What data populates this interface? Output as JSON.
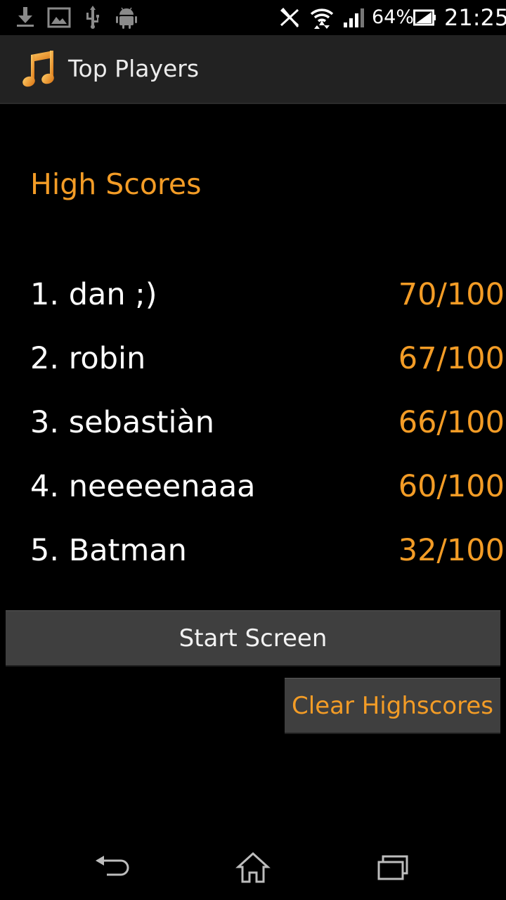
{
  "status_bar": {
    "icons_left": [
      "download-icon",
      "image-icon",
      "usb-icon",
      "android-debug-icon"
    ],
    "icons_right": [
      "nfc-off-icon",
      "wifi-icon",
      "signal-icon"
    ],
    "battery_percent": "64%",
    "time": "21:25"
  },
  "action_bar": {
    "icon": "music-note-icon",
    "title": "Top Players"
  },
  "main": {
    "section_title": "High Scores",
    "scores": [
      {
        "player": "1. dan ;)",
        "score": "70/100"
      },
      {
        "player": "2. robin",
        "score": "67/100"
      },
      {
        "player": "3. sebastiàn",
        "score": "66/100"
      },
      {
        "player": "4. neeeeenaaa",
        "score": "60/100"
      },
      {
        "player": "5. Batman",
        "score": "32/100"
      }
    ],
    "start_button": "Start Screen",
    "clear_button": "Clear Highscores"
  },
  "nav_bar": {
    "buttons": [
      "back-icon",
      "home-icon",
      "recents-icon"
    ]
  },
  "colors": {
    "accent": "#f39c26",
    "background": "#000000",
    "action_bar": "#222222",
    "button": "#3f3f3f"
  }
}
